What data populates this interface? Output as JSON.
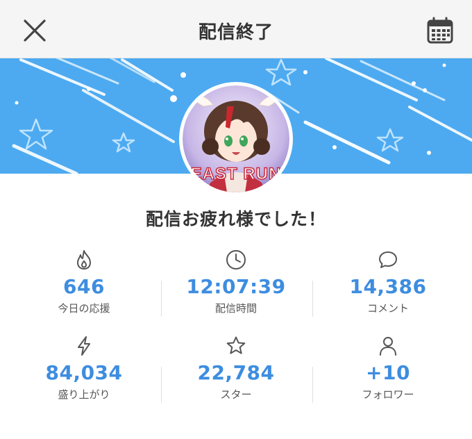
{
  "header": {
    "title": "配信終了",
    "close_icon": "close-icon",
    "calendar_icon": "calendar-icon"
  },
  "banner": {
    "background_color": "#4daaf0",
    "decoration": "stars-and-shooting-lines"
  },
  "avatar": {
    "text_overlay": "EAST RUN"
  },
  "message": "配信お疲れ様でした！",
  "stats": [
    {
      "icon": "flame-icon",
      "value": "646",
      "label": "今日の応援"
    },
    {
      "icon": "clock-icon",
      "value": "12:07:39",
      "label": "配信時間"
    },
    {
      "icon": "comment-icon",
      "value": "14,386",
      "label": "コメント"
    },
    {
      "icon": "lightning-icon",
      "value": "84,034",
      "label": "盛り上がり"
    },
    {
      "icon": "star-icon",
      "value": "22,784",
      "label": "スター"
    },
    {
      "icon": "user-icon",
      "value": "+10",
      "label": "フォロワー"
    }
  ],
  "colors": {
    "accent_value": "#3d8de0",
    "header_bg": "#f5f5f5"
  }
}
